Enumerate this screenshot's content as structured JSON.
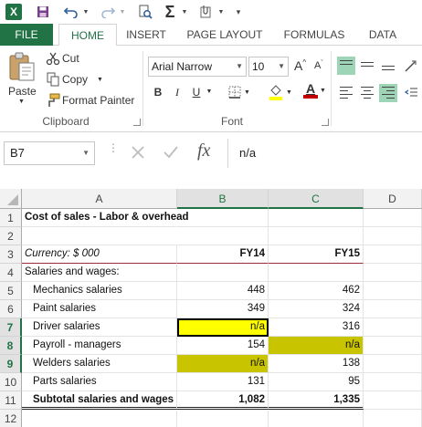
{
  "ribbon_tabs": [
    "FILE",
    "HOME",
    "INSERT",
    "PAGE LAYOUT",
    "FORMULAS",
    "DATA"
  ],
  "clipboard": {
    "paste": "Paste",
    "cut": "Cut",
    "copy": "Copy",
    "format_painter": "Format Painter",
    "group_label": "Clipboard"
  },
  "font": {
    "font_name": "Arial Narrow",
    "font_size": "10",
    "group_label": "Font",
    "bold": "B",
    "italic": "I",
    "underline": "U",
    "grow": "A",
    "shrink": "A",
    "font_color_letter": "A",
    "font_color": "#c00000",
    "fill_color": "#ffff00"
  },
  "formula_bar": {
    "name_box": "B7",
    "fx": "fx",
    "formula": "n/a"
  },
  "columns": [
    "A",
    "B",
    "C",
    "D"
  ],
  "rows": [
    {
      "num": "1",
      "a": "Cost of sales - Labor & overhead",
      "b": "",
      "c": ""
    },
    {
      "num": "2",
      "a": "",
      "b": "",
      "c": ""
    },
    {
      "num": "3",
      "a": "Currency: $ 000",
      "b": "FY14",
      "c": "FY15"
    },
    {
      "num": "4",
      "a": "Salaries and wages:",
      "b": "",
      "c": ""
    },
    {
      "num": "5",
      "a": "Mechanics salaries",
      "b": "448",
      "c": "462"
    },
    {
      "num": "6",
      "a": "Paint salaries",
      "b": "349",
      "c": "324"
    },
    {
      "num": "7",
      "a": "Driver salaries",
      "b": "n/a",
      "c": "316"
    },
    {
      "num": "8",
      "a": "Payroll - managers",
      "b": "154",
      "c": "n/a"
    },
    {
      "num": "9",
      "a": "Welders salaries",
      "b": "n/a",
      "c": "138"
    },
    {
      "num": "10",
      "a": "Parts salaries",
      "b": "131",
      "c": "95"
    },
    {
      "num": "11",
      "a": "Subtotal salaries and wages",
      "b": "1,082",
      "c": "1,335"
    },
    {
      "num": "12",
      "a": "",
      "b": "",
      "c": ""
    }
  ],
  "colors": {
    "excel_green": "#217346",
    "highlight_yellow": "#ffff00",
    "highlight_olive": "#c9c400",
    "selected_header": "#217346"
  }
}
